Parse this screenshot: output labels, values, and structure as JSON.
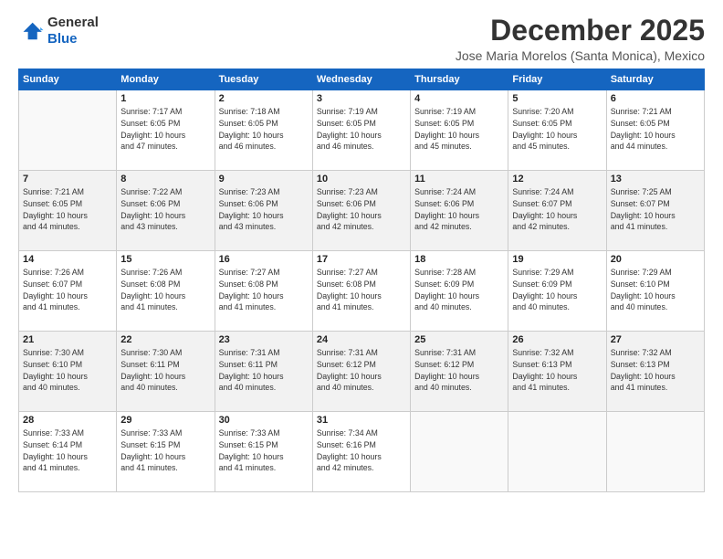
{
  "header": {
    "logo_general": "General",
    "logo_blue": "Blue",
    "month": "December 2025",
    "location": "Jose Maria Morelos (Santa Monica), Mexico"
  },
  "weekdays": [
    "Sunday",
    "Monday",
    "Tuesday",
    "Wednesday",
    "Thursday",
    "Friday",
    "Saturday"
  ],
  "weeks": [
    [
      {
        "day": "",
        "info": ""
      },
      {
        "day": "1",
        "info": "Sunrise: 7:17 AM\nSunset: 6:05 PM\nDaylight: 10 hours\nand 47 minutes."
      },
      {
        "day": "2",
        "info": "Sunrise: 7:18 AM\nSunset: 6:05 PM\nDaylight: 10 hours\nand 46 minutes."
      },
      {
        "day": "3",
        "info": "Sunrise: 7:19 AM\nSunset: 6:05 PM\nDaylight: 10 hours\nand 46 minutes."
      },
      {
        "day": "4",
        "info": "Sunrise: 7:19 AM\nSunset: 6:05 PM\nDaylight: 10 hours\nand 45 minutes."
      },
      {
        "day": "5",
        "info": "Sunrise: 7:20 AM\nSunset: 6:05 PM\nDaylight: 10 hours\nand 45 minutes."
      },
      {
        "day": "6",
        "info": "Sunrise: 7:21 AM\nSunset: 6:05 PM\nDaylight: 10 hours\nand 44 minutes."
      }
    ],
    [
      {
        "day": "7",
        "info": "Sunrise: 7:21 AM\nSunset: 6:05 PM\nDaylight: 10 hours\nand 44 minutes."
      },
      {
        "day": "8",
        "info": "Sunrise: 7:22 AM\nSunset: 6:06 PM\nDaylight: 10 hours\nand 43 minutes."
      },
      {
        "day": "9",
        "info": "Sunrise: 7:23 AM\nSunset: 6:06 PM\nDaylight: 10 hours\nand 43 minutes."
      },
      {
        "day": "10",
        "info": "Sunrise: 7:23 AM\nSunset: 6:06 PM\nDaylight: 10 hours\nand 42 minutes."
      },
      {
        "day": "11",
        "info": "Sunrise: 7:24 AM\nSunset: 6:06 PM\nDaylight: 10 hours\nand 42 minutes."
      },
      {
        "day": "12",
        "info": "Sunrise: 7:24 AM\nSunset: 6:07 PM\nDaylight: 10 hours\nand 42 minutes."
      },
      {
        "day": "13",
        "info": "Sunrise: 7:25 AM\nSunset: 6:07 PM\nDaylight: 10 hours\nand 41 minutes."
      }
    ],
    [
      {
        "day": "14",
        "info": "Sunrise: 7:26 AM\nSunset: 6:07 PM\nDaylight: 10 hours\nand 41 minutes."
      },
      {
        "day": "15",
        "info": "Sunrise: 7:26 AM\nSunset: 6:08 PM\nDaylight: 10 hours\nand 41 minutes."
      },
      {
        "day": "16",
        "info": "Sunrise: 7:27 AM\nSunset: 6:08 PM\nDaylight: 10 hours\nand 41 minutes."
      },
      {
        "day": "17",
        "info": "Sunrise: 7:27 AM\nSunset: 6:08 PM\nDaylight: 10 hours\nand 41 minutes."
      },
      {
        "day": "18",
        "info": "Sunrise: 7:28 AM\nSunset: 6:09 PM\nDaylight: 10 hours\nand 40 minutes."
      },
      {
        "day": "19",
        "info": "Sunrise: 7:29 AM\nSunset: 6:09 PM\nDaylight: 10 hours\nand 40 minutes."
      },
      {
        "day": "20",
        "info": "Sunrise: 7:29 AM\nSunset: 6:10 PM\nDaylight: 10 hours\nand 40 minutes."
      }
    ],
    [
      {
        "day": "21",
        "info": "Sunrise: 7:30 AM\nSunset: 6:10 PM\nDaylight: 10 hours\nand 40 minutes."
      },
      {
        "day": "22",
        "info": "Sunrise: 7:30 AM\nSunset: 6:11 PM\nDaylight: 10 hours\nand 40 minutes."
      },
      {
        "day": "23",
        "info": "Sunrise: 7:31 AM\nSunset: 6:11 PM\nDaylight: 10 hours\nand 40 minutes."
      },
      {
        "day": "24",
        "info": "Sunrise: 7:31 AM\nSunset: 6:12 PM\nDaylight: 10 hours\nand 40 minutes."
      },
      {
        "day": "25",
        "info": "Sunrise: 7:31 AM\nSunset: 6:12 PM\nDaylight: 10 hours\nand 40 minutes."
      },
      {
        "day": "26",
        "info": "Sunrise: 7:32 AM\nSunset: 6:13 PM\nDaylight: 10 hours\nand 41 minutes."
      },
      {
        "day": "27",
        "info": "Sunrise: 7:32 AM\nSunset: 6:13 PM\nDaylight: 10 hours\nand 41 minutes."
      }
    ],
    [
      {
        "day": "28",
        "info": "Sunrise: 7:33 AM\nSunset: 6:14 PM\nDaylight: 10 hours\nand 41 minutes."
      },
      {
        "day": "29",
        "info": "Sunrise: 7:33 AM\nSunset: 6:15 PM\nDaylight: 10 hours\nand 41 minutes."
      },
      {
        "day": "30",
        "info": "Sunrise: 7:33 AM\nSunset: 6:15 PM\nDaylight: 10 hours\nand 41 minutes."
      },
      {
        "day": "31",
        "info": "Sunrise: 7:34 AM\nSunset: 6:16 PM\nDaylight: 10 hours\nand 42 minutes."
      },
      {
        "day": "",
        "info": ""
      },
      {
        "day": "",
        "info": ""
      },
      {
        "day": "",
        "info": ""
      }
    ]
  ]
}
